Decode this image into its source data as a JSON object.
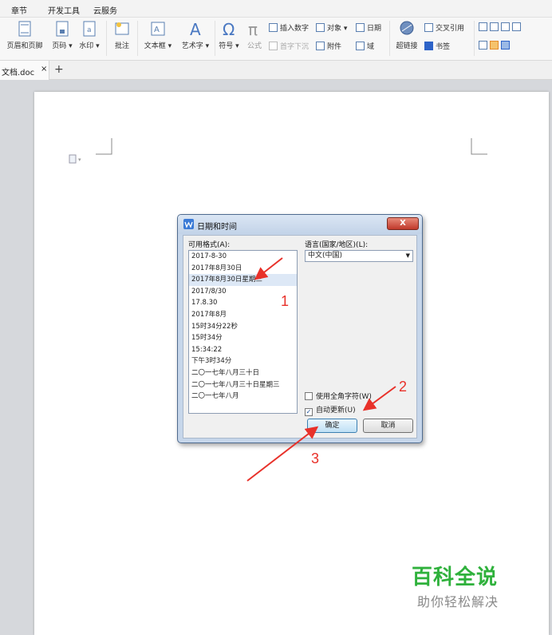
{
  "menubar": {
    "items": [
      "章节",
      "开发工具",
      "云服务"
    ]
  },
  "ribbon": {
    "header_footer": "页眉和页脚",
    "page_number": "页码",
    "watermark": "水印",
    "comment": "批注",
    "textbox": "文本框",
    "wordart": "艺术字",
    "symbol": "符号",
    "formula": "公式",
    "insert_number": "插入数字",
    "first_drop": "首字下沉",
    "object": "对象",
    "attachment": "附件",
    "date": "日期",
    "field": "域",
    "hyperlink": "超链接",
    "cross_ref": "交叉引用",
    "bookmark": "书签"
  },
  "tab": {
    "filename": "文档.doc",
    "close": "×",
    "new": "+"
  },
  "dialog": {
    "title": "日期和时间",
    "close": "X",
    "formats_label": "可用格式(A):",
    "formats": [
      "2017-8-30",
      "2017年8月30日",
      "2017年8月30日星期三",
      "2017/8/30",
      "17.8.30",
      "2017年8月",
      "15时34分22秒",
      "15时34分",
      "15:34:22",
      "下午3时34分",
      "二〇一七年八月三十日",
      "二〇一七年八月三十日星期三",
      "二〇一七年八月"
    ],
    "selected_index": 2,
    "language_label": "语言(国家/地区)(L):",
    "language_value": "中文(中国)",
    "fullwidth_label": "使用全角字符(W)",
    "autoupdate_label": "自动更新(U)",
    "autoupdate_checked": true,
    "ok": "确定",
    "cancel": "取消"
  },
  "annotations": {
    "n1": "1",
    "n2": "2",
    "n3": "3"
  },
  "watermark": {
    "title": "百科全说",
    "subtitle": "助你轻松解决"
  },
  "colors": {
    "arrow": "#e8312a",
    "watermark_green": "#2fb13c",
    "dialog_frame": "#c6d6ea"
  }
}
